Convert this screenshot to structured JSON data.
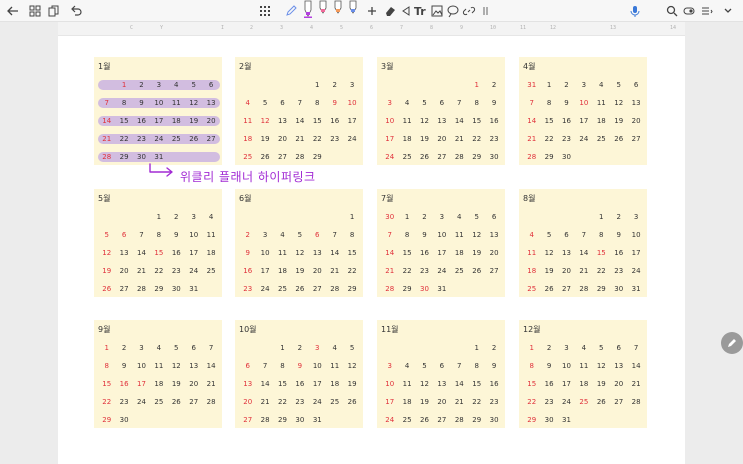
{
  "toolbar": {
    "icons": [
      "back-arrow-icon",
      "grid-view-icon",
      "page-export-icon",
      "undo-icon",
      "keyboard-toggle-icon",
      "pencil-icon",
      "pen-purple-icon",
      "pen-pink-icon",
      "pen-orange-icon",
      "pen-blue-icon",
      "add-icon",
      "eraser-icon",
      "lasso-icon",
      "text-icon",
      "image-icon",
      "shape-icon",
      "link-icon",
      "more-vertical-icon",
      "microphone-icon",
      "search-icon",
      "reading-mode-icon",
      "page-list-icon",
      "chevron-down-icon"
    ],
    "text_tool_label": "Tr",
    "colors": {
      "pen_purple": "#b43fe0",
      "pen_pink": "#f06a9a",
      "pen_orange": "#f59a5a",
      "pen_blue": "#6a8ee8",
      "accent_mic": "#3a78d8"
    }
  },
  "ruler": {
    "ticks": [
      "C",
      "Y",
      "I",
      "2",
      "3",
      "4",
      "5",
      "6",
      "7",
      "8",
      "9",
      "10",
      "11",
      "12",
      "13",
      "14"
    ]
  },
  "annotation": {
    "text": "위클리 플래너 하이퍼링크",
    "color": "#a22bd4"
  },
  "months": [
    {
      "title": "1월",
      "rows": [
        [
          "",
          "1",
          "2",
          "3",
          "4",
          "5",
          "6"
        ],
        [
          "7",
          "8",
          "9",
          "10",
          "11",
          "12",
          "13"
        ],
        [
          "14",
          "15",
          "16",
          "17",
          "18",
          "19",
          "20"
        ],
        [
          "21",
          "22",
          "23",
          "24",
          "25",
          "26",
          "27"
        ],
        [
          "28",
          "29",
          "30",
          "31",
          "",
          "",
          ""
        ]
      ],
      "red": [
        "1",
        "7",
        "14",
        "21",
        "28"
      ],
      "highlighted": true
    },
    {
      "title": "2월",
      "rows": [
        [
          "",
          "",
          "",
          "",
          "1",
          "2",
          "3"
        ],
        [
          "4",
          "5",
          "6",
          "7",
          "8",
          "9",
          "10"
        ],
        [
          "11",
          "12",
          "13",
          "14",
          "15",
          "16",
          "17"
        ],
        [
          "18",
          "19",
          "20",
          "21",
          "22",
          "23",
          "24"
        ],
        [
          "25",
          "26",
          "27",
          "28",
          "29",
          "",
          ""
        ]
      ],
      "red": [
        "4",
        "9",
        "10",
        "11",
        "12",
        "18",
        "25"
      ]
    },
    {
      "title": "3월",
      "rows": [
        [
          "",
          "",
          "",
          "",
          "",
          "1",
          "2"
        ],
        [
          "3",
          "4",
          "5",
          "6",
          "7",
          "8",
          "9"
        ],
        [
          "10",
          "11",
          "12",
          "13",
          "14",
          "15",
          "16"
        ],
        [
          "17",
          "18",
          "19",
          "20",
          "21",
          "22",
          "23"
        ],
        [
          "24",
          "25",
          "26",
          "27",
          "28",
          "29",
          "30"
        ]
      ],
      "red": [
        "1",
        "3",
        "10",
        "17",
        "24"
      ]
    },
    {
      "title": "4월",
      "rows": [
        [
          "31",
          "1",
          "2",
          "3",
          "4",
          "5",
          "6"
        ],
        [
          "7",
          "8",
          "9",
          "10",
          "11",
          "12",
          "13"
        ],
        [
          "14",
          "15",
          "16",
          "17",
          "18",
          "19",
          "20"
        ],
        [
          "21",
          "22",
          "23",
          "24",
          "25",
          "26",
          "27"
        ],
        [
          "28",
          "29",
          "30",
          "",
          "",
          "",
          ""
        ]
      ],
      "red": [
        "31",
        "7",
        "10",
        "14",
        "21",
        "28"
      ]
    },
    {
      "title": "5월",
      "rows": [
        [
          "",
          "",
          "",
          "1",
          "2",
          "3",
          "4"
        ],
        [
          "5",
          "6",
          "7",
          "8",
          "9",
          "10",
          "11"
        ],
        [
          "12",
          "13",
          "14",
          "15",
          "16",
          "17",
          "18"
        ],
        [
          "19",
          "20",
          "21",
          "22",
          "23",
          "24",
          "25"
        ],
        [
          "26",
          "27",
          "28",
          "29",
          "30",
          "31",
          ""
        ]
      ],
      "red": [
        "5",
        "6",
        "12",
        "15",
        "19",
        "26"
      ]
    },
    {
      "title": "6월",
      "rows": [
        [
          "",
          "",
          "",
          "",
          "",
          "",
          "1"
        ],
        [
          "2",
          "3",
          "4",
          "5",
          "6",
          "7",
          "8"
        ],
        [
          "9",
          "10",
          "11",
          "12",
          "13",
          "14",
          "15"
        ],
        [
          "16",
          "17",
          "18",
          "19",
          "20",
          "21",
          "22"
        ],
        [
          "23",
          "24",
          "25",
          "26",
          "27",
          "28",
          "29"
        ]
      ],
      "red": [
        "2",
        "6",
        "9",
        "16",
        "23"
      ]
    },
    {
      "title": "7월",
      "rows": [
        [
          "30",
          "1",
          "2",
          "3",
          "4",
          "5",
          "6"
        ],
        [
          "7",
          "8",
          "9",
          "10",
          "11",
          "12",
          "13"
        ],
        [
          "14",
          "15",
          "16",
          "17",
          "18",
          "19",
          "20"
        ],
        [
          "21",
          "22",
          "23",
          "24",
          "25",
          "26",
          "27"
        ],
        [
          "28",
          "29",
          "30",
          "31",
          "",
          "",
          ""
        ]
      ],
      "red": [
        "30",
        "7",
        "14",
        "21",
        "28"
      ]
    },
    {
      "title": "8월",
      "rows": [
        [
          "",
          "",
          "",
          "",
          "1",
          "2",
          "3"
        ],
        [
          "4",
          "5",
          "6",
          "7",
          "8",
          "9",
          "10"
        ],
        [
          "11",
          "12",
          "13",
          "14",
          "15",
          "16",
          "17"
        ],
        [
          "18",
          "19",
          "20",
          "21",
          "22",
          "23",
          "24"
        ],
        [
          "25",
          "26",
          "27",
          "28",
          "29",
          "30",
          "31"
        ]
      ],
      "red": [
        "4",
        "11",
        "15",
        "18",
        "25"
      ]
    },
    {
      "title": "9월",
      "rows": [
        [
          "1",
          "2",
          "3",
          "4",
          "5",
          "6",
          "7"
        ],
        [
          "8",
          "9",
          "10",
          "11",
          "12",
          "13",
          "14"
        ],
        [
          "15",
          "16",
          "17",
          "18",
          "19",
          "20",
          "21"
        ],
        [
          "22",
          "23",
          "24",
          "25",
          "26",
          "27",
          "28"
        ],
        [
          "29",
          "30",
          "",
          "",
          "",
          "",
          ""
        ]
      ],
      "red": [
        "1",
        "8",
        "15",
        "16",
        "17",
        "22",
        "29"
      ]
    },
    {
      "title": "10월",
      "rows": [
        [
          "",
          "",
          "1",
          "2",
          "3",
          "4",
          "5"
        ],
        [
          "6",
          "7",
          "8",
          "9",
          "10",
          "11",
          "12"
        ],
        [
          "13",
          "14",
          "15",
          "16",
          "17",
          "18",
          "19"
        ],
        [
          "20",
          "21",
          "22",
          "23",
          "24",
          "25",
          "26"
        ],
        [
          "27",
          "28",
          "29",
          "30",
          "31",
          "",
          ""
        ]
      ],
      "red": [
        "3",
        "6",
        "9",
        "13",
        "20",
        "27"
      ]
    },
    {
      "title": "11월",
      "rows": [
        [
          "",
          "",
          "",
          "",
          "",
          "1",
          "2"
        ],
        [
          "3",
          "4",
          "5",
          "6",
          "7",
          "8",
          "9"
        ],
        [
          "10",
          "11",
          "12",
          "13",
          "14",
          "15",
          "16"
        ],
        [
          "17",
          "18",
          "19",
          "20",
          "21",
          "22",
          "23"
        ],
        [
          "24",
          "25",
          "26",
          "27",
          "28",
          "29",
          "30"
        ]
      ],
      "red": [
        "3",
        "10",
        "17",
        "24"
      ]
    },
    {
      "title": "12월",
      "rows": [
        [
          "1",
          "2",
          "3",
          "4",
          "5",
          "6",
          "7"
        ],
        [
          "8",
          "9",
          "10",
          "11",
          "12",
          "13",
          "14"
        ],
        [
          "15",
          "16",
          "17",
          "18",
          "19",
          "20",
          "21"
        ],
        [
          "22",
          "23",
          "24",
          "25",
          "26",
          "27",
          "28"
        ],
        [
          "29",
          "30",
          "31",
          "",
          "",
          "",
          ""
        ]
      ],
      "red": [
        "1",
        "8",
        "15",
        "22",
        "25",
        "29"
      ]
    }
  ]
}
